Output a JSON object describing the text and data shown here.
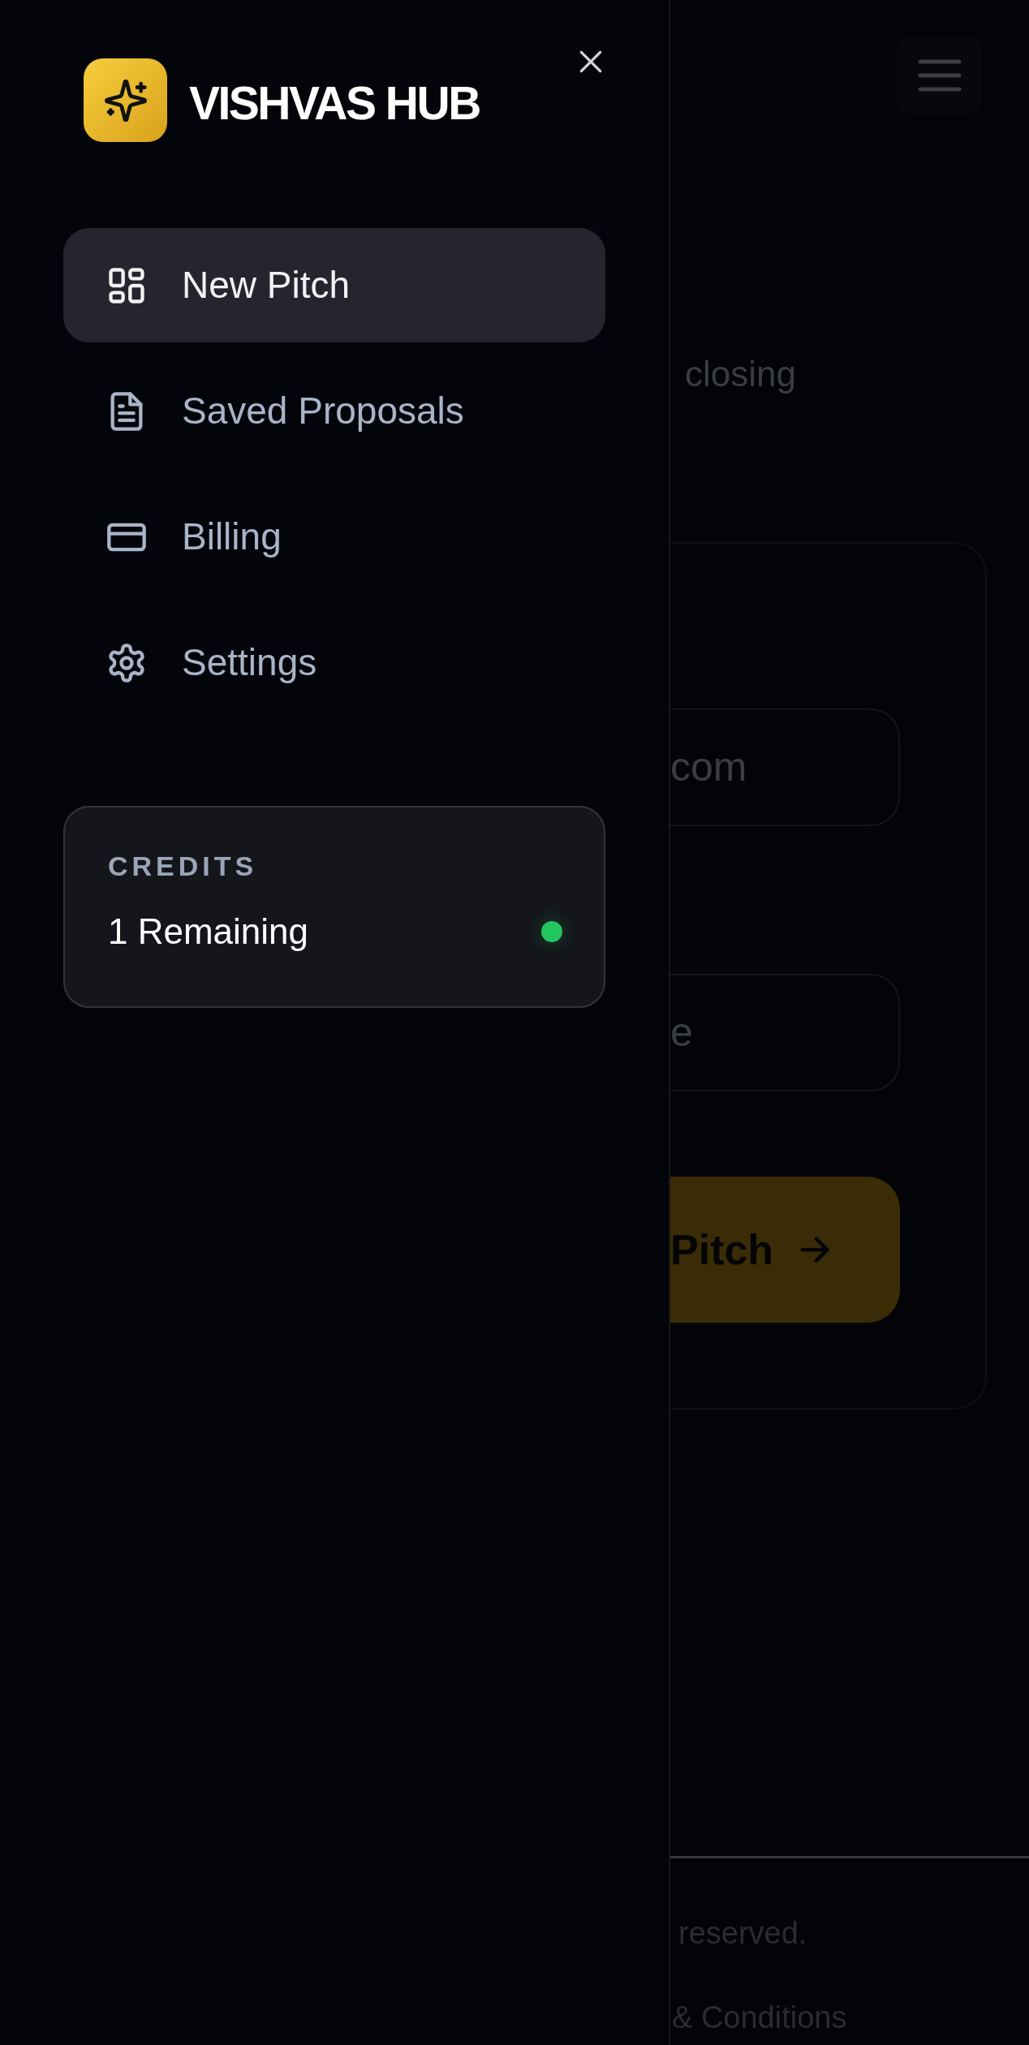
{
  "sidebar": {
    "brand": "VISHVAS HUB",
    "items": [
      {
        "label": "New Pitch",
        "kind": "grid",
        "selected": true
      },
      {
        "label": "Saved Proposals",
        "kind": "document",
        "selected": false
      },
      {
        "label": "Billing",
        "kind": "card",
        "selected": false
      },
      {
        "label": "Settings",
        "kind": "gear",
        "selected": false
      }
    ],
    "credits": {
      "label": "CREDITS",
      "value": "1 Remaining"
    }
  },
  "main": {
    "subtitle": "closing",
    "fields": [
      {
        "placeholder": "com"
      },
      {
        "placeholder": "e"
      }
    ],
    "button": "Pitch",
    "footer": [
      "reserved.",
      "& Conditions"
    ]
  }
}
